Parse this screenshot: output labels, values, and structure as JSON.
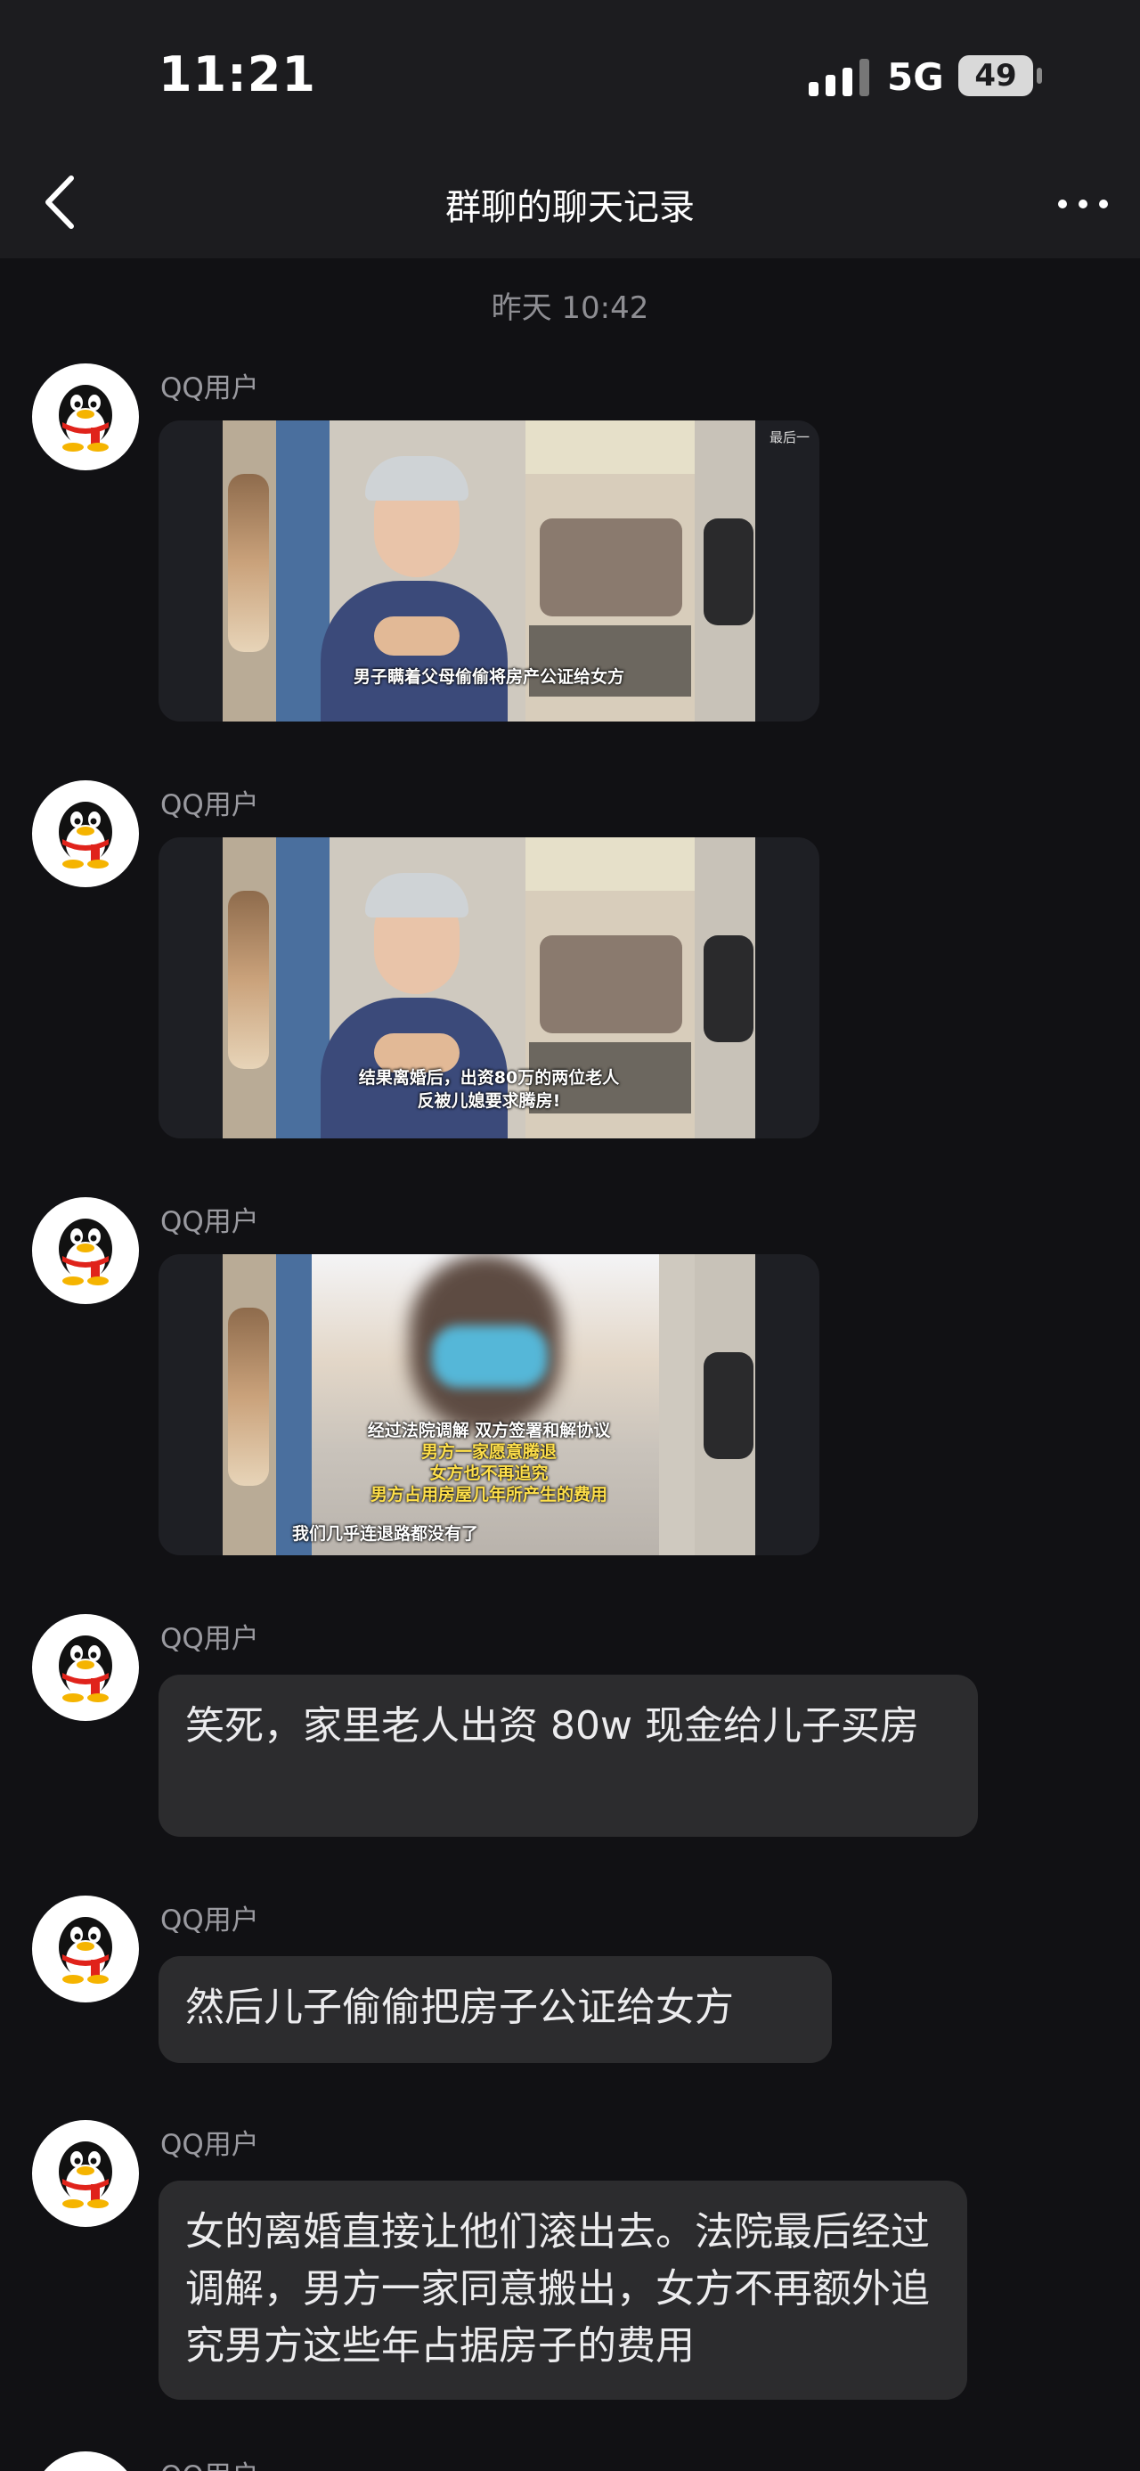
{
  "status_bar": {
    "time": "11:21",
    "network": "5G",
    "battery": "49"
  },
  "nav": {
    "title": "群聊的聊天记录"
  },
  "chat": {
    "timestamp": "昨天 10:42",
    "messages": [
      {
        "sender": "QQ用户",
        "type": "video",
        "captions": [
          "男子瞒着父母偷偷将房产公证给女方"
        ],
        "corner": "最后一"
      },
      {
        "sender": "QQ用户",
        "type": "video",
        "captions": [
          "结果离婚后，出资80万的两位老人",
          "反被儿媳要求腾房!"
        ],
        "corner": ""
      },
      {
        "sender": "QQ用户",
        "type": "video",
        "captions": [
          "经过法院调解 双方签署和解协议",
          "男方一家愿意腾退",
          "女方也不再追究",
          "男方占用房屋几年所产生的费用",
          "我们几乎连退路都没有了"
        ],
        "corner": ""
      },
      {
        "sender": "QQ用户",
        "type": "text",
        "text": "笑死，家里老人出资 80w 现金给儿子买房"
      },
      {
        "sender": "QQ用户",
        "type": "text",
        "text": "然后儿子偷偷把房子公证给女方"
      },
      {
        "sender": "QQ用户",
        "type": "text",
        "text": "女的离婚直接让他们滚出去。法院最后经过调解，男方一家同意搬出，女方不再额外追究男方这些年占据房子的费用"
      },
      {
        "sender": "QQ用户",
        "type": "partial"
      }
    ]
  },
  "icons": {
    "back": "chevron-left-icon",
    "more": "more-dots-icon",
    "avatar": "qq-penguin-icon"
  }
}
